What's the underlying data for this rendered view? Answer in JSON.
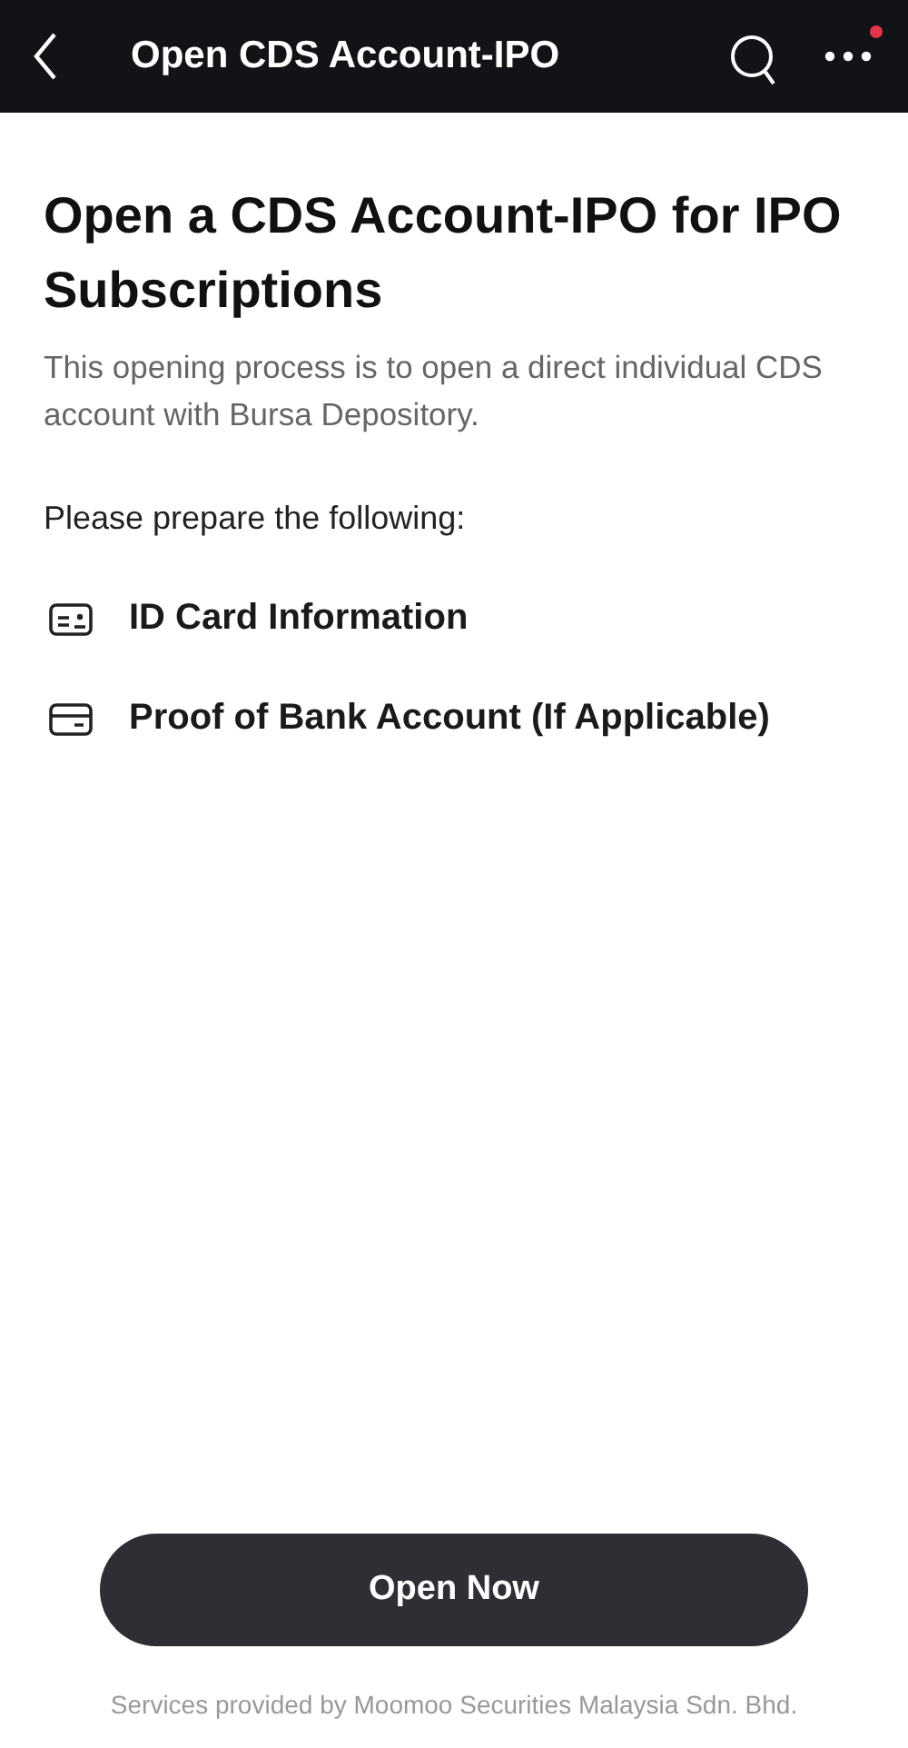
{
  "header": {
    "title": "Open CDS Account-IPO",
    "menu_notification": true
  },
  "heading": "Open a CDS Account-IPO for IPO Subscriptions",
  "description": "This opening process is to open a direct individual CDS account with Bursa Depository.",
  "prepare_label": "Please prepare the following:",
  "requirements": [
    {
      "kind": "id-card",
      "label": "ID Card Information"
    },
    {
      "kind": "bank-card",
      "label": "Proof of Bank Account (If Applicable)"
    }
  ],
  "button": "Open Now",
  "footer": "Services provided by Moomoo Securities Malaysia Sdn. Bhd."
}
